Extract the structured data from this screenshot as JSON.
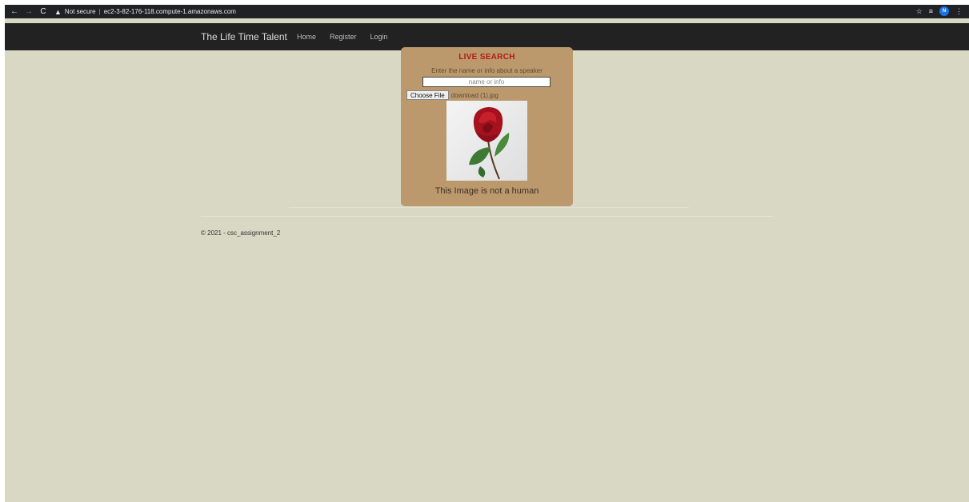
{
  "browser": {
    "security_label": "Not secure",
    "url": "ec2-3-82-176-118.compute-1.amazonaws.com",
    "profile_initial": "N"
  },
  "navbar": {
    "brand": "The Life Time Talent",
    "links": [
      "Home",
      "Register",
      "Login"
    ]
  },
  "search_panel": {
    "title": "LIVE SEARCH",
    "hint": "Enter the name or info about a speaker",
    "input_placeholder": "name or info",
    "file_button": "Choose File",
    "file_name": "download (1).jpg",
    "result_text": "This Image is not a human"
  },
  "footer": {
    "text": "© 2021 - csc_assignment_2"
  },
  "colors": {
    "page_bg": "#d9d8c5",
    "navbar_bg": "#222222",
    "panel_bg": "#bc996c",
    "title_red": "#b31a1a"
  }
}
